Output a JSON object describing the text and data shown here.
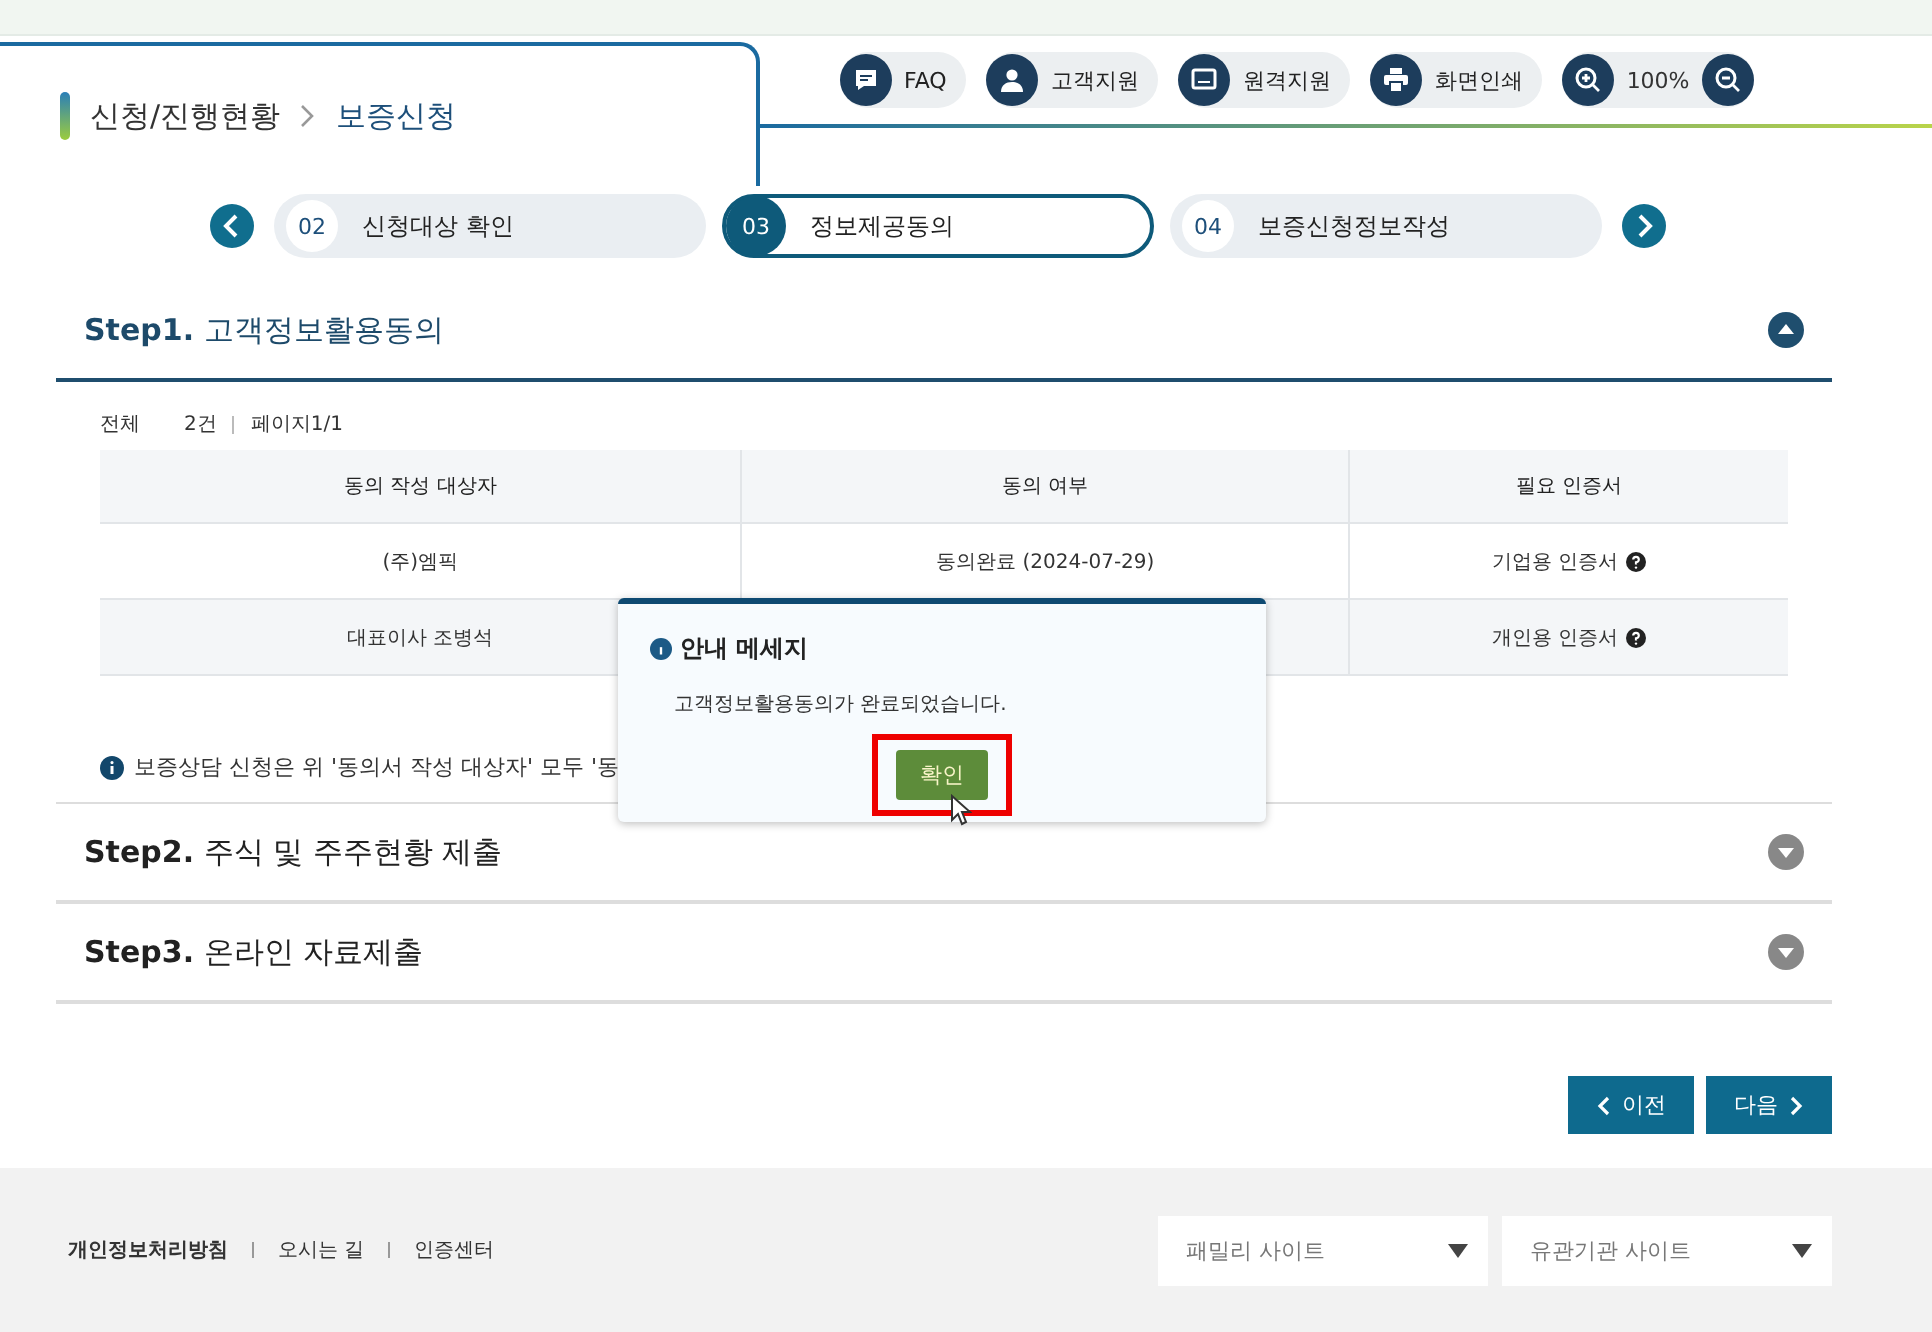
{
  "breadcrumb": [
    "신청/진행현황",
    "보증신청"
  ],
  "toolbar": [
    {
      "kind": "chat",
      "label": "FAQ"
    },
    {
      "kind": "person",
      "label": "고객지원"
    },
    {
      "kind": "monitor",
      "label": "원격지원"
    },
    {
      "kind": "print",
      "label": "화면인쇄"
    }
  ],
  "zoom": {
    "value": "100%"
  },
  "steps": [
    {
      "number": "02",
      "label": "신청대상 확인",
      "selected": false
    },
    {
      "number": "03",
      "label": "정보제공동의",
      "selected": true
    },
    {
      "number": "04",
      "label": "보증신청정보작성",
      "selected": false
    }
  ],
  "sections": [
    {
      "title_prefix": "Step1.",
      "title": "고객정보활용동의",
      "expanded": true
    },
    {
      "title_prefix": "Step2.",
      "title": "주식 및 주주현황 제출",
      "expanded": false
    },
    {
      "title_prefix": "Step3.",
      "title": "온라인 자료제출",
      "expanded": false
    }
  ],
  "summary": {
    "total_label": "전체",
    "total": "2건",
    "page": "페이지1/1"
  },
  "table": {
    "columns": [
      "동의 작성 대상자",
      "동의 여부",
      "필요 인증서"
    ],
    "rows": [
      [
        "(주)엠픽",
        "동의완료 (2024-07-29)",
        "기업용 인증서"
      ],
      [
        "대표이사 조병석",
        "",
        "개인용 인증서"
      ]
    ]
  },
  "note": "보증상담 신청은 위 '동의서 작성 대상자' 모두 '동",
  "dialog": {
    "title": "안내 메세지",
    "message": "고객정보활용동의가 완료되었습니다.",
    "button": "확인"
  },
  "nav_buttons": [
    {
      "kind": "prev",
      "label": "이전"
    },
    {
      "kind": "next",
      "label": "다음"
    }
  ],
  "footer": {
    "links": [
      "개인정보처리방침",
      "오시는 길",
      "인증센터"
    ],
    "selects": [
      "패밀리 사이트",
      "유관기관 사이트"
    ]
  }
}
